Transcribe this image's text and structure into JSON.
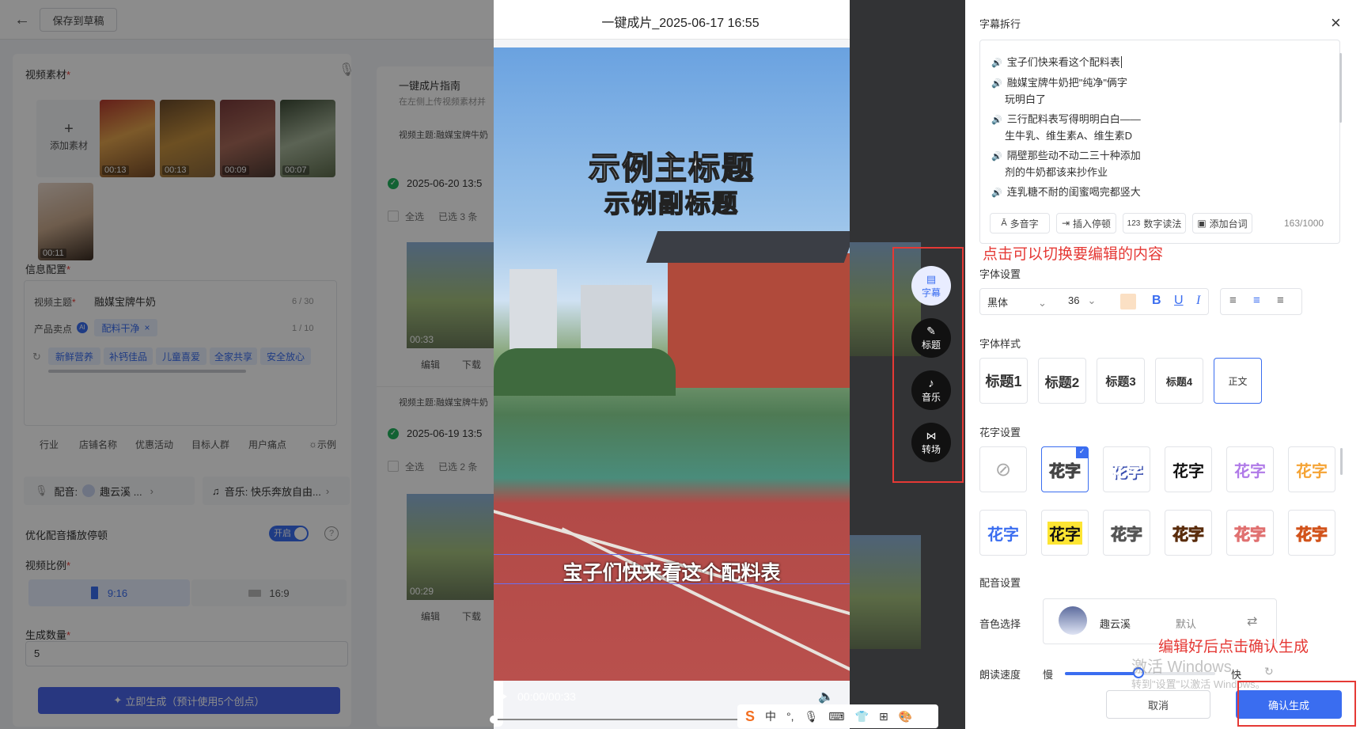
{
  "topbar": {
    "back_icon": "arrow-left-icon",
    "save_draft": "保存到草稿",
    "title": "一键成片_2025-06-17 16:55"
  },
  "left": {
    "video_material": "视频素材",
    "add_material": "添加素材",
    "thumbs": [
      "00:13",
      "00:13",
      "00:09",
      "00:07",
      "00:11"
    ],
    "info_config": "信息配置",
    "video_topic_label": "视频主题",
    "video_topic_value": "融媒宝牌牛奶",
    "video_topic_count": "6 / 30",
    "selling_point_label": "产品卖点",
    "selling_point_chip": "配料干净",
    "selling_point_count": "1 / 10",
    "suggest_tags": [
      "新鲜营养",
      "补钙佳品",
      "儿童喜爱",
      "全家共享",
      "安全放心"
    ],
    "bottom_tags": [
      "行业",
      "店铺名称",
      "优惠活动",
      "目标人群",
      "用户痛点",
      "示例"
    ],
    "voice_label": "配音:",
    "voice_value": "趣云溪 ...",
    "music_label": "音乐: 快乐奔放自由...",
    "optimize_label": "优化配音播放停顿",
    "toggle_text": "开启",
    "ratio_label": "视频比例",
    "ratio_916": "9:16",
    "ratio_169": "16:9",
    "count_label": "生成数量",
    "count_value": "5",
    "generate_btn": "立即生成（预计使用5个创点）"
  },
  "mid": {
    "guide_title": "一键成片指南",
    "guide_sub": "在左侧上传视频素材并",
    "topic1": "视频主题:融媒宝牌牛奶",
    "date1": "2025-06-20 13:5",
    "select_all": "全选",
    "selected1": "已选 3 条",
    "dur1": "00:33",
    "edit": "编辑",
    "download": "下载",
    "topic2": "视频主题:融媒宝牌牛奶",
    "date2": "2025-06-19 13:5",
    "selected2": "已选 2 条",
    "dur2": "00:29"
  },
  "preview": {
    "main_title": "示例主标题",
    "sub_title": "示例副标题",
    "subtitle_line": "宝子们快来看这个配料表",
    "time": "00:00/00:33",
    "side_buttons": [
      {
        "icon": "subtitle-icon",
        "label": "字幕"
      },
      {
        "icon": "pen-icon",
        "label": "标题"
      },
      {
        "icon": "music-note-icon",
        "label": "音乐"
      },
      {
        "icon": "transition-icon",
        "label": "转场"
      }
    ]
  },
  "ime": {
    "items": [
      "中",
      "°,",
      "☺",
      "⌨",
      "👕",
      "⊞",
      "🎨"
    ]
  },
  "right": {
    "section_split": "字幕拆行",
    "lines": [
      [
        "宝子们快来看这个配料表"
      ],
      [
        "融媒宝牌牛奶把\"纯净\"俩字",
        "玩明白了"
      ],
      [
        "三行配料表写得明明白白——",
        "生牛乳、维生素A、维生素D"
      ],
      [
        "隔壁那些动不动二三十种添加",
        "剂的牛奶都该来抄作业"
      ],
      [
        "连乳糖不耐的闺蜜喝完都竖大"
      ]
    ],
    "tools": [
      "多音字",
      "插入停顿",
      "数字读法",
      "添加台词"
    ],
    "char_count": "163/1000",
    "annotation_top": "点击可以切换要编辑的内容",
    "font_settings": "字体设置",
    "font_name": "黑体",
    "font_size": "36",
    "font_style_title": "字体样式",
    "font_styles": [
      "标题1",
      "标题2",
      "标题3",
      "标题4",
      "正文"
    ],
    "fancy_title": "花字设置",
    "fancy_text": "花字",
    "voice_settings": "配音设置",
    "voice_select_label": "音色选择",
    "voice_name": "趣云溪",
    "voice_default": "默认",
    "annotation_bottom": "编辑好后点击确认生成",
    "speed_label": "朗读速度",
    "slow": "慢",
    "fast": "快",
    "watermark1": "激活 Windows",
    "watermark2": "转到\"设置\"以激活 Windows。",
    "cancel": "取消",
    "confirm": "确认生成"
  },
  "colors": {
    "accent": "#3a6df0",
    "annotation": "#e53935"
  }
}
